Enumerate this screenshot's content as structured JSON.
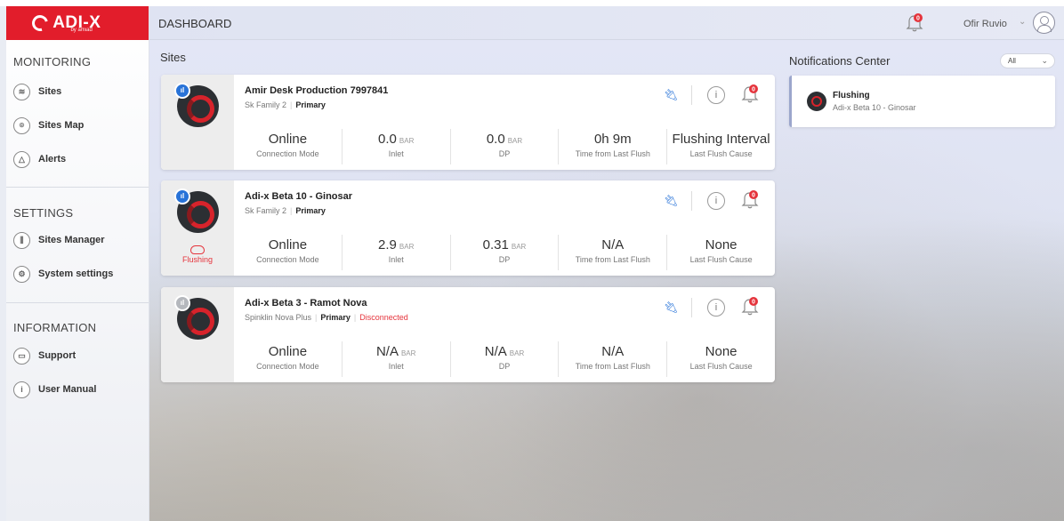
{
  "brand": {
    "logo_text": "ADI-X",
    "logo_sub": "by amiad"
  },
  "header": {
    "title": "DASHBOARD",
    "notifications_count": "0",
    "user_name": "Ofir Ruvio"
  },
  "sidebar": {
    "sections": [
      {
        "title": "MONITORING",
        "items": [
          {
            "label": "Sites",
            "icon": "layers-icon"
          },
          {
            "label": "Sites Map",
            "icon": "map-pin-icon"
          },
          {
            "label": "Alerts",
            "icon": "bell-icon"
          }
        ]
      },
      {
        "title": "SETTINGS",
        "items": [
          {
            "label": "Sites Manager",
            "icon": "sliders-icon"
          },
          {
            "label": "System settings",
            "icon": "gear-icon"
          }
        ]
      },
      {
        "title": "INFORMATION",
        "items": [
          {
            "label": "Support",
            "icon": "chat-icon"
          },
          {
            "label": "User Manual",
            "icon": "info-icon"
          }
        ]
      }
    ]
  },
  "main": {
    "sites_title": "Sites",
    "sites": [
      {
        "name": "Amir Desk Production 7997841",
        "family": "Sk Family 2",
        "role": "Primary",
        "status_note": "",
        "flushing_label": "",
        "alert_count": "0",
        "metrics": [
          {
            "value": "Online",
            "unit": "",
            "label": "Connection Mode"
          },
          {
            "value": "0.0",
            "unit": "BAR",
            "label": "Inlet"
          },
          {
            "value": "0.0",
            "unit": "BAR",
            "label": "DP"
          },
          {
            "value": "0h 9m",
            "unit": "",
            "label": "Time from Last Flush"
          },
          {
            "value": "Flushing Interval",
            "unit": "",
            "label": "Last Flush Cause"
          }
        ]
      },
      {
        "name": "Adi-x Beta 10 - Ginosar",
        "family": "Sk Family 2",
        "role": "Primary",
        "status_note": "",
        "flushing_label": "Flushing",
        "alert_count": "0",
        "metrics": [
          {
            "value": "Online",
            "unit": "",
            "label": "Connection Mode"
          },
          {
            "value": "2.9",
            "unit": "BAR",
            "label": "Inlet"
          },
          {
            "value": "0.31",
            "unit": "BAR",
            "label": "DP"
          },
          {
            "value": "N/A",
            "unit": "",
            "label": "Time from Last Flush"
          },
          {
            "value": "None",
            "unit": "",
            "label": "Last Flush Cause"
          }
        ]
      },
      {
        "name": "Adi-x Beta 3 - Ramot Nova",
        "family": "Spinklin Nova Plus",
        "role": "Primary",
        "status_note": "Disconnected",
        "flushing_label": "",
        "alert_count": "0",
        "metrics": [
          {
            "value": "Online",
            "unit": "",
            "label": "Connection Mode"
          },
          {
            "value": "N/A",
            "unit": "BAR",
            "label": "Inlet"
          },
          {
            "value": "N/A",
            "unit": "BAR",
            "label": "DP"
          },
          {
            "value": "N/A",
            "unit": "",
            "label": "Time from Last Flush"
          },
          {
            "value": "None",
            "unit": "",
            "label": "Last Flush Cause"
          }
        ]
      }
    ]
  },
  "notifications": {
    "title": "Notifications Center",
    "filter_value": "All",
    "items": [
      {
        "title": "Flushing",
        "subtitle": "Adi-x Beta 10 - Ginosar"
      }
    ]
  },
  "colors": {
    "brand": "#e21d2b",
    "accent": "#2873d8",
    "alert": "#e5343c"
  }
}
